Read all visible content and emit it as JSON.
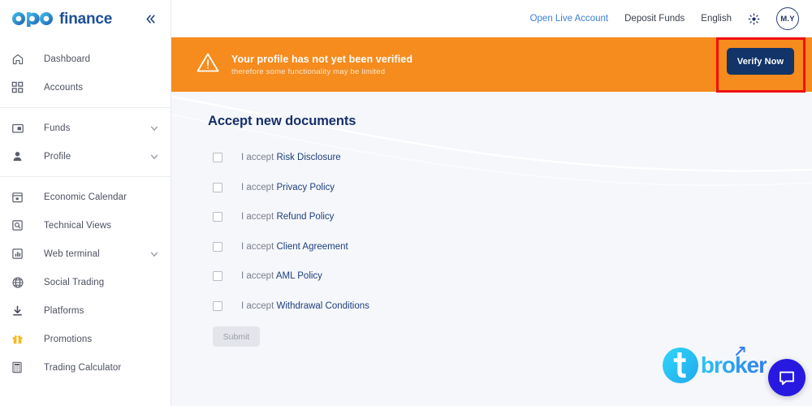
{
  "brand": {
    "logo_text": "finance",
    "logo_mark": "opo-logo-icon"
  },
  "sidebar": {
    "collapse_icon": "chevron-double-left-icon",
    "groups": [
      {
        "items": [
          {
            "label": "Dashboard",
            "icon": "home-icon",
            "expandable": false
          },
          {
            "label": "Accounts",
            "icon": "grid-icon",
            "expandable": false
          }
        ]
      },
      {
        "items": [
          {
            "label": "Funds",
            "icon": "wallet-icon",
            "expandable": true
          },
          {
            "label": "Profile",
            "icon": "user-icon",
            "expandable": true
          }
        ]
      },
      {
        "items": [
          {
            "label": "Economic Calendar",
            "icon": "calendar-icon",
            "expandable": false
          },
          {
            "label": "Technical Views",
            "icon": "search-box-icon",
            "expandable": false
          },
          {
            "label": "Web terminal",
            "icon": "bar-chart-icon",
            "expandable": true
          },
          {
            "label": "Social Trading",
            "icon": "globe-icon",
            "expandable": false
          },
          {
            "label": "Platforms",
            "icon": "download-icon",
            "expandable": false
          },
          {
            "label": "Promotions",
            "icon": "gift-icon",
            "expandable": false
          },
          {
            "label": "Trading Calculator",
            "icon": "calculator-icon",
            "expandable": false
          }
        ]
      }
    ]
  },
  "topbar": {
    "open_live_account": "Open Live Account",
    "deposit_funds": "Deposit Funds",
    "language": "English",
    "theme_icon": "sun-icon",
    "avatar_initials": "M.Y"
  },
  "banner": {
    "icon": "warning-triangle-icon",
    "title": "Your profile has not yet been verified",
    "subtitle": "therefore some functionality may be limited",
    "verify_label": "Verify Now",
    "background_color": "#f68b1e",
    "button_color": "#123468",
    "highlight_color": "#f01010"
  },
  "main": {
    "title": "Accept new documents",
    "accept_prefix": "I accept ",
    "documents": [
      {
        "name": "Risk Disclosure",
        "checked": false
      },
      {
        "name": "Privacy Policy",
        "checked": false
      },
      {
        "name": "Refund Policy",
        "checked": false
      },
      {
        "name": "Client Agreement",
        "checked": false
      },
      {
        "name": "AML Policy",
        "checked": false
      },
      {
        "name": "Withdrawal Conditions",
        "checked": false
      }
    ],
    "submit_label": "Submit",
    "submit_disabled": true
  },
  "footer": {
    "broker_logo_mark": "tbroker-t-icon",
    "broker_word": "broker",
    "chat_icon": "chat-bubble-icon",
    "chat_color": "#2719e0"
  }
}
